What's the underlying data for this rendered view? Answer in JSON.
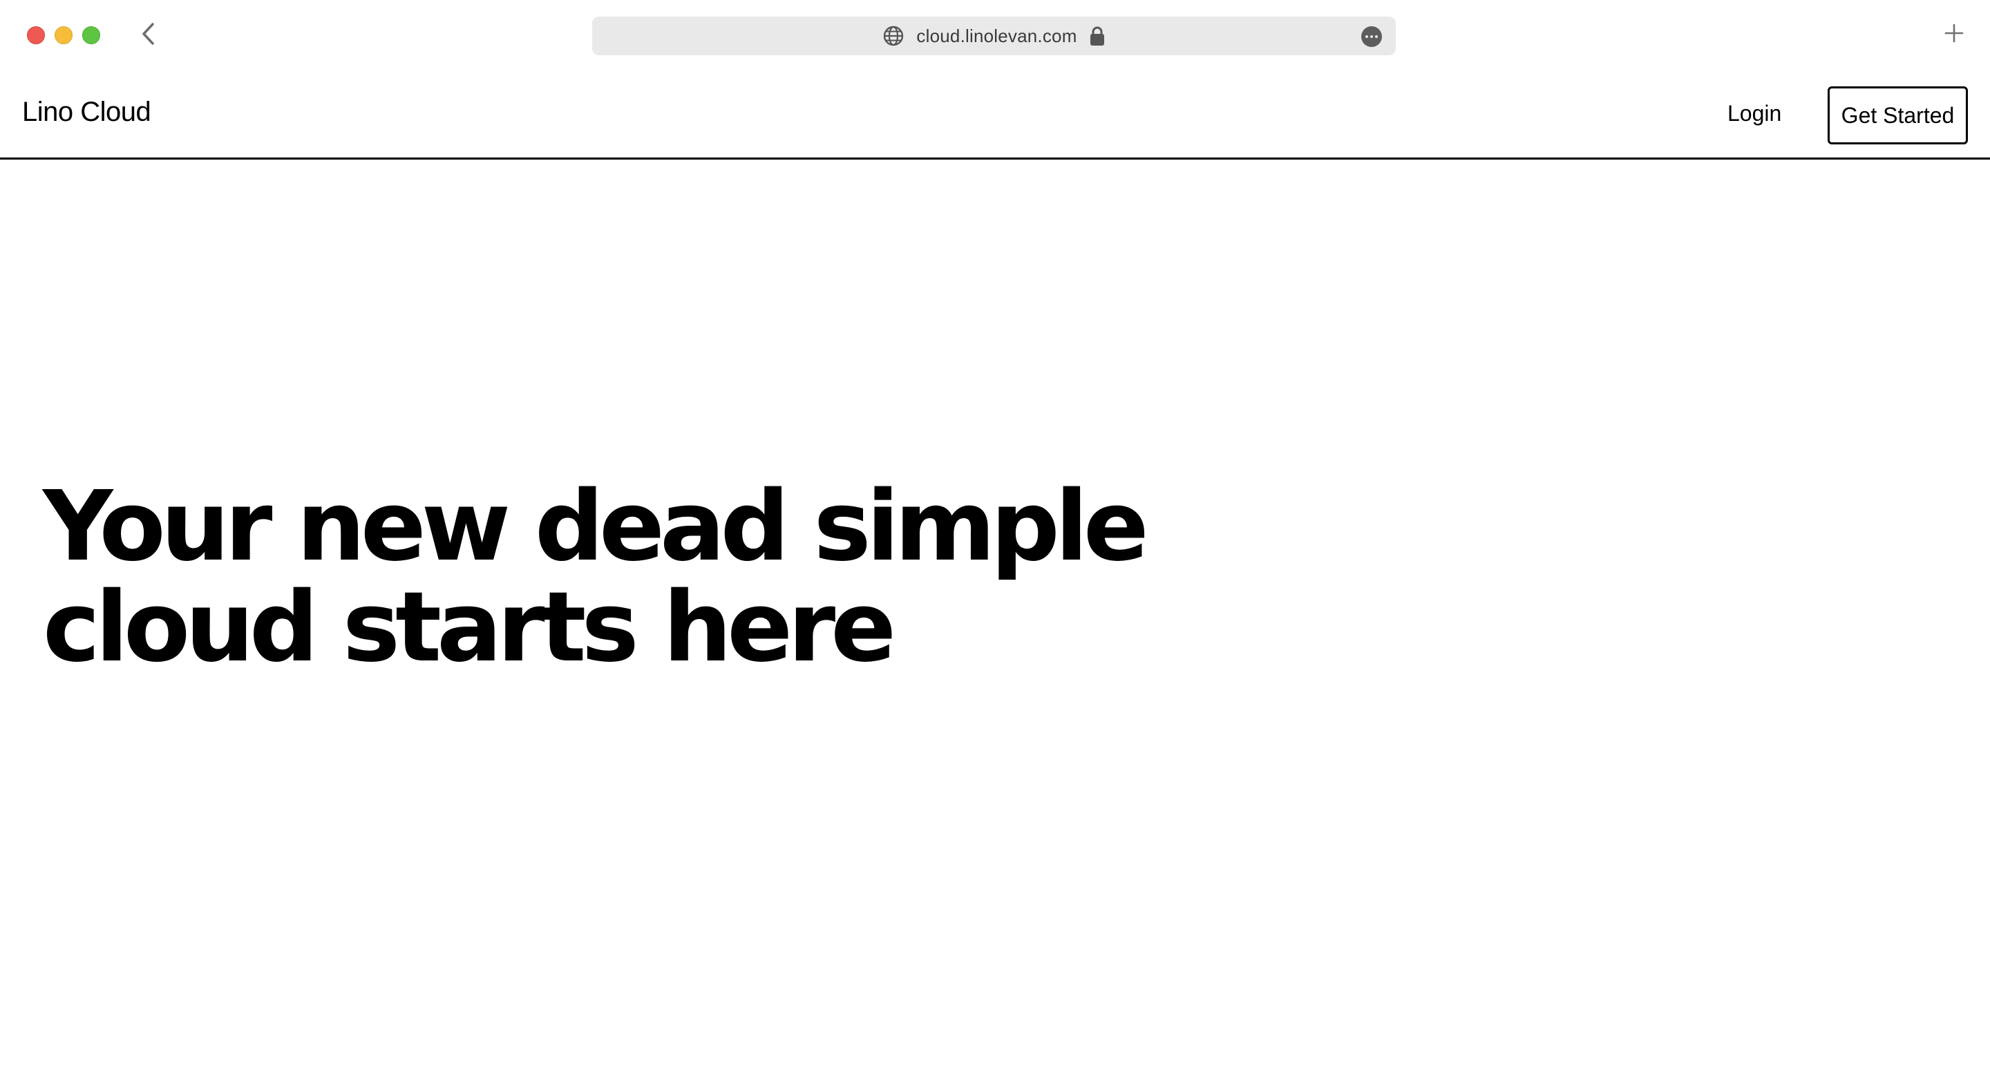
{
  "browser": {
    "url": "cloud.linolevan.com",
    "icons": {
      "back": "chevron-left-icon",
      "site": "globe-icon",
      "secure": "lock-icon",
      "more": "ellipsis-circle-icon",
      "new_tab": "plus-icon"
    },
    "traffic_lights": {
      "close": "#ee5a52",
      "minimize": "#f5bd3a",
      "zoom": "#5ec443"
    }
  },
  "nav": {
    "logo": "Lino Cloud",
    "login_label": "Login",
    "cta_label": "Get Started"
  },
  "hero": {
    "title_line1": "Your new dead simple",
    "title_line2": "cloud starts here"
  },
  "colors": {
    "background": "#ffffff",
    "text": "#000000",
    "address_bar": "#e9e9e9"
  }
}
